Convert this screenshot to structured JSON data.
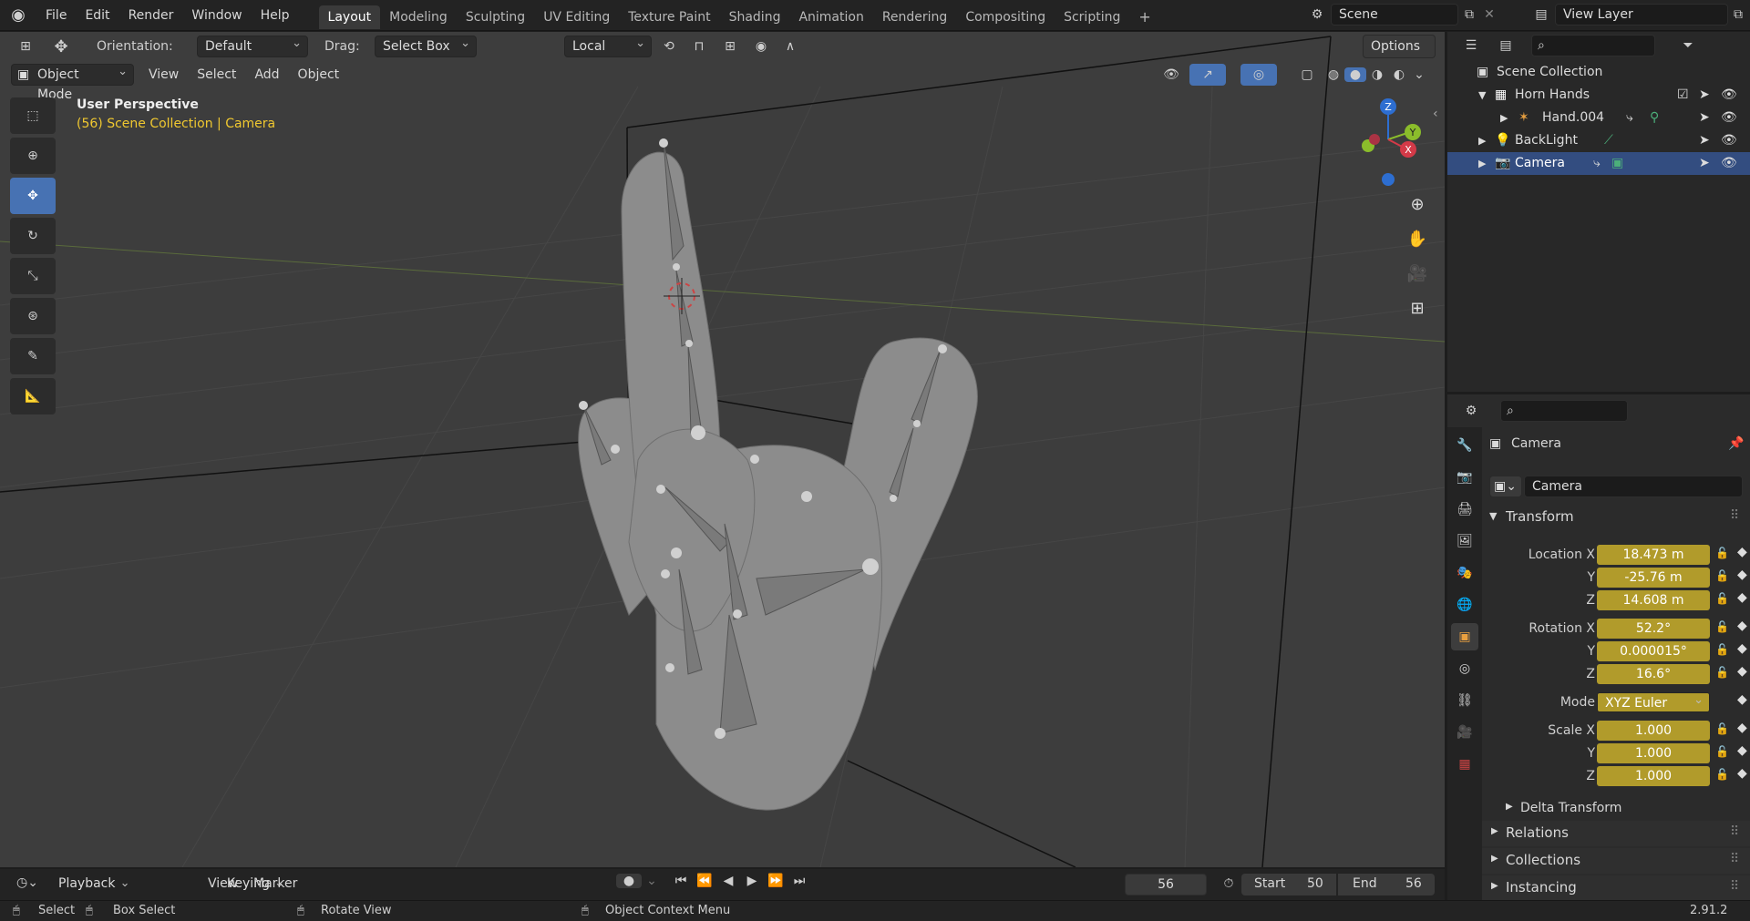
{
  "topbar": {
    "menus": [
      "File",
      "Edit",
      "Render",
      "Window",
      "Help"
    ],
    "workspaces": [
      "Layout",
      "Modeling",
      "Sculpting",
      "UV Editing",
      "Texture Paint",
      "Shading",
      "Animation",
      "Rendering",
      "Compositing",
      "Scripting"
    ],
    "active_workspace": "Layout",
    "scene": "Scene",
    "view_layer": "View Layer"
  },
  "viewport_header": {
    "orientation_label": "Orientation:",
    "orientation_value": "Default",
    "drag_label": "Drag:",
    "drag_value": "Select Box",
    "transform_space": "Local",
    "options_label": "Options",
    "mode": "Object Mode",
    "menus": [
      "View",
      "Select",
      "Add",
      "Object"
    ]
  },
  "viewport": {
    "perspective": "User Perspective",
    "context": "(56) Scene Collection | Camera",
    "gizmo_axes": [
      "Z",
      "Y",
      "X"
    ]
  },
  "outliner": {
    "root": "Scene Collection",
    "items": [
      {
        "name": "Horn Hands",
        "level": 1,
        "icon": "collection-icon",
        "selected": false
      },
      {
        "name": "Hand.004",
        "level": 2,
        "icon": "armature-icon",
        "selected": false
      },
      {
        "name": "BackLight",
        "level": 1,
        "icon": "light-icon",
        "selected": false
      },
      {
        "name": "Camera",
        "level": 1,
        "icon": "camera-icon",
        "selected": true
      }
    ]
  },
  "properties": {
    "object_name": "Camera",
    "data_name": "Camera",
    "transform_title": "Transform",
    "location": {
      "label": "Location X",
      "x": "18.473 m",
      "y": "-25.76 m",
      "z": "14.608 m"
    },
    "rotation": {
      "label": "Rotation X",
      "x": "52.2°",
      "y": "0.000015°",
      "z": "16.6°"
    },
    "mode_label": "Mode",
    "mode_value": "XYZ Euler",
    "scale": {
      "label": "Scale X",
      "x": "1.000",
      "y": "1.000",
      "z": "1.000"
    },
    "axis_y": "Y",
    "axis_z": "Z",
    "sections": [
      "Delta Transform",
      "Relations",
      "Collections",
      "Instancing"
    ]
  },
  "timeline": {
    "menus": [
      "Playback",
      "Keying",
      "View",
      "Marker"
    ],
    "current_frame": "56",
    "start_label": "Start",
    "start": "50",
    "end_label": "End",
    "end": "56"
  },
  "statusbar": {
    "select": "Select",
    "box_select": "Box Select",
    "rotate_view": "Rotate View",
    "context_menu": "Object Context Menu",
    "version": "2.91.2"
  },
  "colors": {
    "accent": "#4772b3",
    "field_yellow": "#b19b2b",
    "selected_row": "#334d80"
  }
}
